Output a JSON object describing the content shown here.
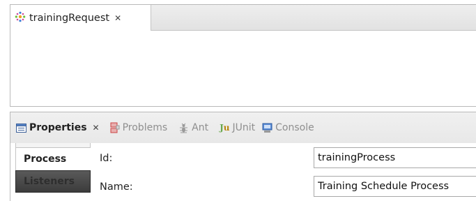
{
  "editor": {
    "tab_title": "trainingRequest",
    "tab_icon": "process-gear-icon"
  },
  "properties_view": {
    "tabs": [
      {
        "label": "Properties",
        "icon": "properties-icon",
        "active": true,
        "closable": true
      },
      {
        "label": "Problems",
        "icon": "problems-icon",
        "active": false
      },
      {
        "label": "Ant",
        "icon": "ant-icon",
        "active": false
      },
      {
        "label": "JUnit",
        "icon": "junit-icon",
        "active": false
      },
      {
        "label": "Console",
        "icon": "console-icon",
        "active": false
      }
    ],
    "side_tabs": [
      {
        "label": "Process",
        "selected": true
      },
      {
        "label": "Listeners",
        "selected": false
      }
    ],
    "fields": [
      {
        "label": "Id:",
        "value": "trainingProcess"
      },
      {
        "label": "Name:",
        "value": "Training Schedule Process"
      }
    ]
  },
  "colors": {
    "tab_bar_bg": "#e6e6e6",
    "border": "#b9b9b9",
    "inactive_text": "#8f8f8f",
    "selected_side_tab_bg": "#ffffff",
    "unselected_side_tab_bg": "#4a4a4a"
  }
}
